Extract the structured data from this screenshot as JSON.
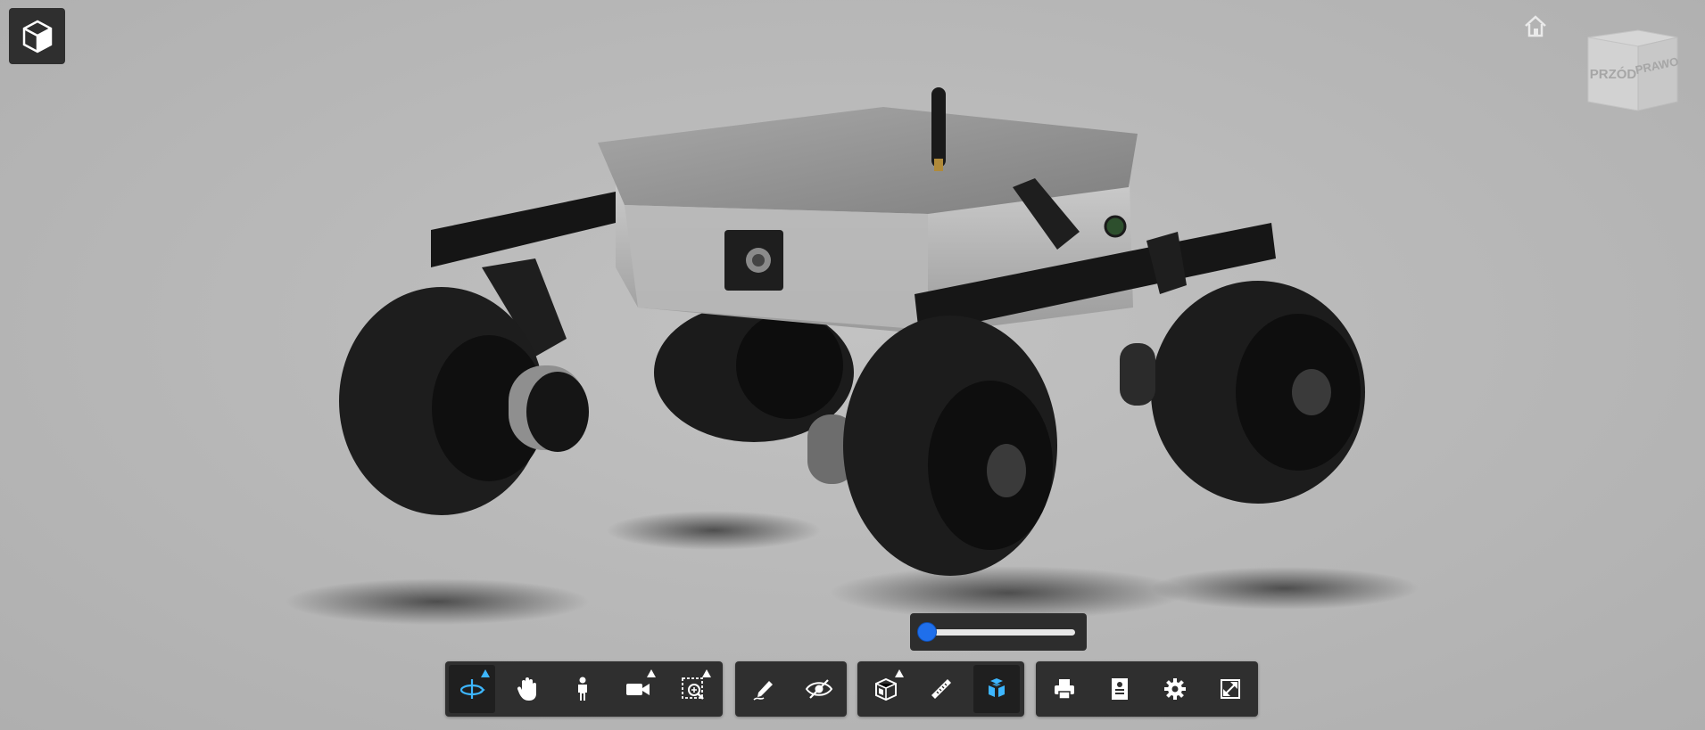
{
  "viewer": {
    "model_button_icon": "model-browser-cube-icon",
    "home_icon": "home-icon",
    "viewcube": {
      "front_label": "PRZÓD",
      "right_label": "PRAWO"
    },
    "explode_slider": {
      "value": 0.0
    },
    "colors": {
      "toolbar_bg": "#2f2f2f",
      "active_accent": "#3db6ff",
      "slider_thumb": "#1f6feb"
    }
  },
  "toolbar": {
    "groups": [
      {
        "tools": [
          {
            "icon": "orbit-icon",
            "active": true,
            "has_submenu": true
          },
          {
            "icon": "pan-hand-icon",
            "active": false,
            "has_submenu": false
          },
          {
            "icon": "first-person-icon",
            "active": false,
            "has_submenu": false
          },
          {
            "icon": "camera-icon",
            "active": false,
            "has_submenu": true
          },
          {
            "icon": "zoom-window-icon",
            "active": false,
            "has_submenu": true
          }
        ]
      },
      {
        "tools": [
          {
            "icon": "markup-pen-icon",
            "active": false,
            "has_submenu": false
          },
          {
            "icon": "hide-eye-icon",
            "active": false,
            "has_submenu": false
          }
        ]
      },
      {
        "tools": [
          {
            "icon": "section-box-icon",
            "active": false,
            "has_submenu": true
          },
          {
            "icon": "measure-ruler-icon",
            "active": false,
            "has_submenu": false
          },
          {
            "icon": "explode-model-icon",
            "active": true,
            "has_submenu": false
          }
        ]
      },
      {
        "tools": [
          {
            "icon": "print-icon",
            "active": false,
            "has_submenu": false
          },
          {
            "icon": "properties-icon",
            "active": false,
            "has_submenu": false
          },
          {
            "icon": "settings-gear-icon",
            "active": false,
            "has_submenu": false
          },
          {
            "icon": "fullscreen-icon",
            "active": false,
            "has_submenu": false
          }
        ]
      }
    ]
  }
}
